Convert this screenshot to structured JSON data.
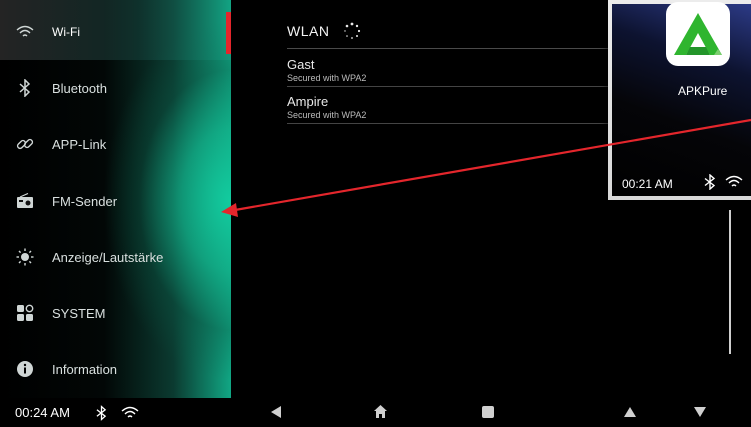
{
  "sidebar": {
    "items": [
      {
        "label": "Wi-Fi",
        "icon": "wifi-icon"
      },
      {
        "label": "Bluetooth",
        "icon": "bluetooth-icon"
      },
      {
        "label": "APP-Link",
        "icon": "link-icon"
      },
      {
        "label": "FM-Sender",
        "icon": "radio-icon"
      },
      {
        "label": "Anzeige/Lautstärke",
        "icon": "brightness-icon"
      },
      {
        "label": "SYSTEM",
        "icon": "system-icon"
      },
      {
        "label": "Information",
        "icon": "info-icon"
      }
    ],
    "active_index": 0
  },
  "main": {
    "title": "WLAN",
    "networks": [
      {
        "name": "Gast",
        "security": "Secured with WPA2"
      },
      {
        "name": "Ampire",
        "security": "Secured with WPA2"
      }
    ]
  },
  "overlay": {
    "app_label": "APKPure",
    "time": "00:21 AM",
    "app_icon": "apkpure-logo-icon"
  },
  "statusbar": {
    "time": "00:24 AM"
  },
  "navbar": {
    "buttons": [
      "back-button",
      "home-button",
      "recents-button",
      "volume-up-button",
      "volume-down-button"
    ]
  },
  "colors": {
    "accent": "#e4262c",
    "teal": "#11c79b",
    "apk_green": "#2fb52f"
  }
}
